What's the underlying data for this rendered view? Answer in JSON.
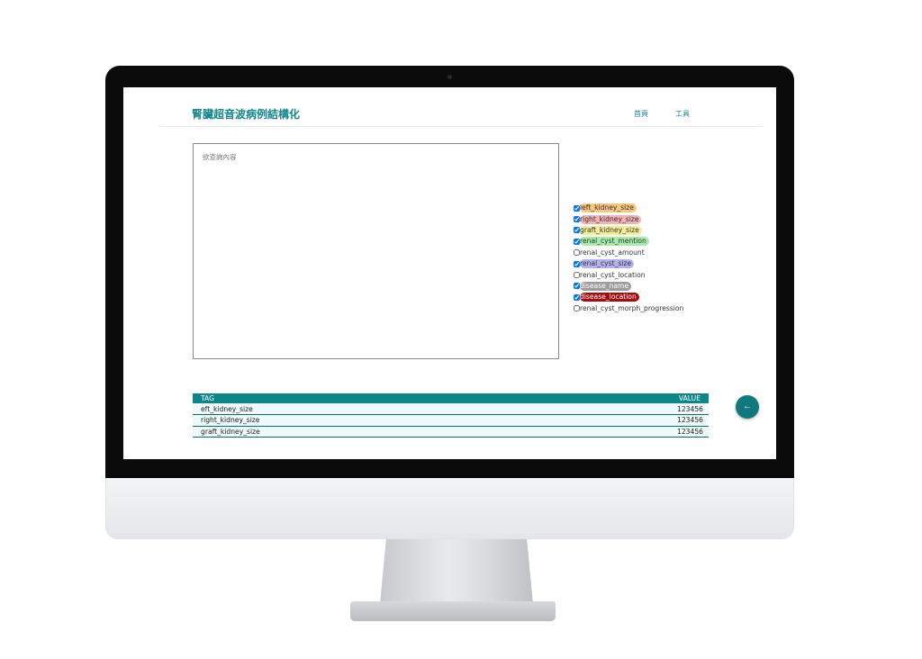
{
  "app": {
    "title": "腎臟超音波病例結構化"
  },
  "nav": {
    "home_label": "首頁",
    "tools_label": "工具"
  },
  "query": {
    "placeholder": "欲查詢內容",
    "value": ""
  },
  "tags": [
    {
      "label": "left_kidney_size",
      "checked": true,
      "color": "#f7c680"
    },
    {
      "label": "right_kidney_size",
      "checked": true,
      "color": "#f3b3b3"
    },
    {
      "label": "graft_kidney_size",
      "checked": true,
      "color": "#f4ee98"
    },
    {
      "label": "renal_cyst_mention",
      "checked": true,
      "color": "#a6ecaa"
    },
    {
      "label": "renal_cyst_amount",
      "checked": false,
      "color": ""
    },
    {
      "label": "renal_cyst_size",
      "checked": true,
      "color": "#b2b3ee"
    },
    {
      "label": "renal_cyst_location",
      "checked": false,
      "color": ""
    },
    {
      "label": "disease_name",
      "checked": true,
      "color": "#9c9c9c"
    },
    {
      "label": "disease_location",
      "checked": true,
      "color": "#a40d0d"
    },
    {
      "label": "renal_cyst_morph_progression",
      "checked": false,
      "color": ""
    }
  ],
  "table": {
    "headers": {
      "tag": "TAG",
      "value": "VALUE"
    },
    "rows": [
      {
        "tag": "eft_kidney_size",
        "value": "123456"
      },
      {
        "tag": "right_kidney_size",
        "value": "123456"
      },
      {
        "tag": "graft_kidney_size",
        "value": "123456"
      }
    ]
  },
  "back_button": {
    "icon": "arrow-left-icon",
    "glyph": "←"
  },
  "colors": {
    "accent": "#14868c",
    "table_header": "#0e8589",
    "table_row": "#eef9f9"
  }
}
